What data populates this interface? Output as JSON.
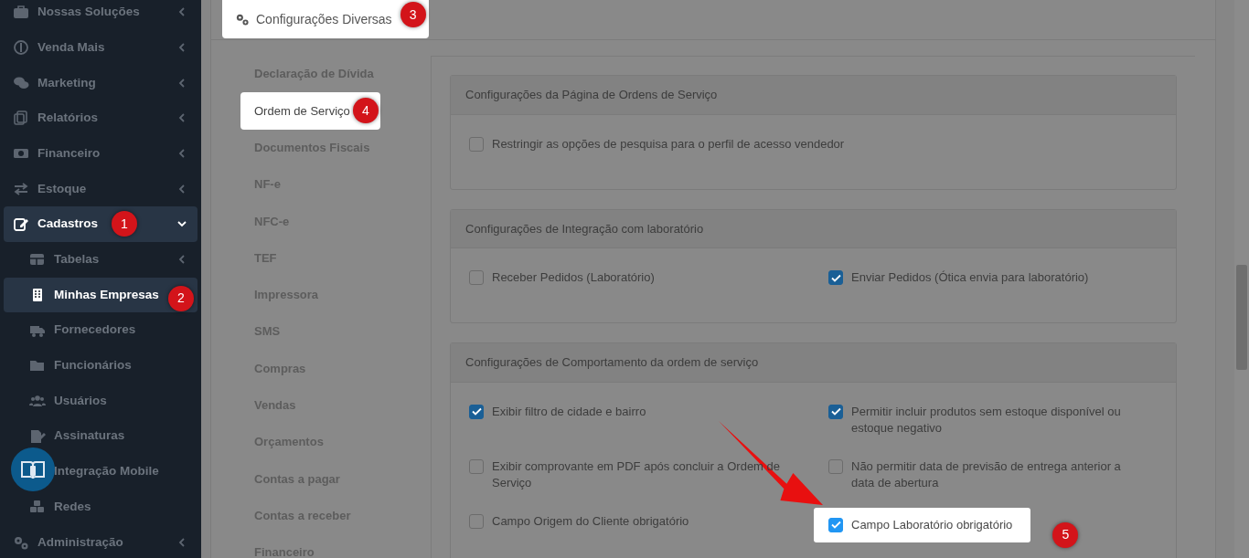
{
  "sidebar": {
    "items": [
      {
        "label": "Nossas Soluções",
        "expanded": false,
        "selected": false
      },
      {
        "label": "Venda Mais",
        "expanded": false,
        "selected": false
      },
      {
        "label": "Marketing",
        "expanded": false,
        "selected": false
      },
      {
        "label": "Relatórios",
        "expanded": false,
        "selected": false
      },
      {
        "label": "Financeiro",
        "expanded": false,
        "selected": false
      },
      {
        "label": "Estoque",
        "expanded": false,
        "selected": false
      },
      {
        "label": "Cadastros",
        "expanded": true,
        "selected": true,
        "callout": "1",
        "children": [
          {
            "label": "Tabelas",
            "expanded": false,
            "selected": false
          },
          {
            "label": "Minhas Empresas",
            "selected": true,
            "callout": "2"
          },
          {
            "label": "Fornecedores",
            "selected": false
          },
          {
            "label": "Funcionários",
            "selected": false
          },
          {
            "label": "Usuários",
            "selected": false
          },
          {
            "label": "Assinaturas",
            "selected": false
          },
          {
            "label": "Integração Mobile",
            "selected": false
          },
          {
            "label": "Redes",
            "selected": false
          }
        ]
      },
      {
        "label": "Administração",
        "expanded": false,
        "selected": false
      }
    ]
  },
  "settings_tab": {
    "label": "Configurações Diversas",
    "callout": "3"
  },
  "vertical_tabs": [
    {
      "label": "Declaração de Dívida",
      "selected": false
    },
    {
      "label": "Ordem de Serviço",
      "selected": true,
      "callout": "4"
    },
    {
      "label": "Documentos Fiscais",
      "selected": false
    },
    {
      "label": "NF-e",
      "selected": false
    },
    {
      "label": "NFC-e",
      "selected": false
    },
    {
      "label": "TEF",
      "selected": false
    },
    {
      "label": "Impressora",
      "selected": false
    },
    {
      "label": "SMS",
      "selected": false
    },
    {
      "label": "Compras",
      "selected": false
    },
    {
      "label": "Vendas",
      "selected": false
    },
    {
      "label": "Orçamentos",
      "selected": false
    },
    {
      "label": "Contas a pagar",
      "selected": false
    },
    {
      "label": "Contas a receber",
      "selected": false
    },
    {
      "label": "Financeiro",
      "selected": false
    }
  ],
  "sections": [
    {
      "title": "Configurações da Página de Ordens de Serviço",
      "options": [
        {
          "label": "Restringir as opções de pesquisa para o perfil de acesso vendedor",
          "checked": false,
          "highlighted": false
        }
      ]
    },
    {
      "title": "Configurações de Integração com laboratório",
      "options": [
        {
          "label": "Receber Pedidos (Laboratório)",
          "checked": false,
          "highlighted": false
        },
        {
          "label": "Enviar Pedidos (Ótica envia para laboratório)",
          "checked": true,
          "highlighted": false
        }
      ]
    },
    {
      "title": "Configurações de Comportamento da ordem de serviço",
      "options": [
        {
          "label": "Exibir filtro de cidade e bairro",
          "checked": true,
          "highlighted": false
        },
        {
          "label": "Permitir incluir produtos sem estoque disponível ou estoque negativo",
          "checked": true,
          "highlighted": false
        },
        {
          "label": "Exibir comprovante em PDF após concluir a Ordem de Serviço",
          "checked": false,
          "highlighted": false
        },
        {
          "label": "Não permitir data de previsão de entrega anterior a data de abertura",
          "checked": false,
          "highlighted": false
        },
        {
          "label": "Campo Origem do Cliente obrigatório",
          "checked": false,
          "highlighted": false
        },
        {
          "label": "Campo Laboratório obrigatório",
          "checked": true,
          "highlighted": true,
          "callout": "5"
        }
      ]
    }
  ]
}
